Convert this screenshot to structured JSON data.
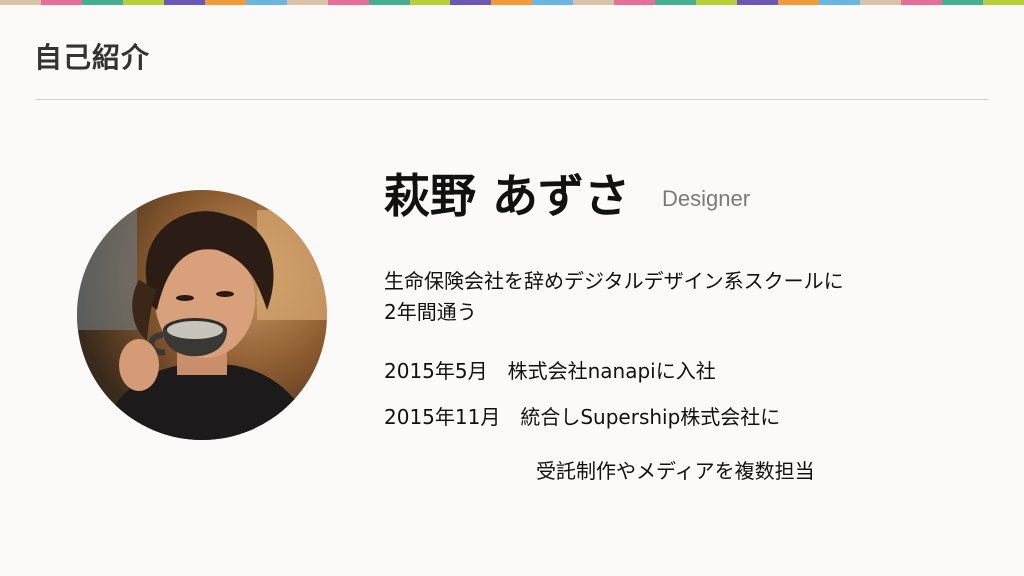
{
  "header": {
    "title": "自己紹介"
  },
  "stripe_colors": [
    "#d8c2a8",
    "#e86e9a",
    "#44b090",
    "#b7cf3a",
    "#6b58b6",
    "#f09a3a",
    "#6bb6e0",
    "#d8c2a8",
    "#e86e9a",
    "#44b090",
    "#b7cf3a",
    "#6b58b6",
    "#f09a3a",
    "#6bb6e0",
    "#d8c2a8",
    "#e86e9a",
    "#44b090",
    "#b7cf3a",
    "#6b58b6",
    "#f09a3a",
    "#6bb6e0",
    "#d8c2a8",
    "#e86e9a",
    "#44b090",
    "#b7cf3a"
  ],
  "profile": {
    "name": "萩野 あずさ",
    "role": "Designer",
    "bio_lines": [
      "生命保険会社を辞めデジタルデザイン系スクールに",
      "2年間通う",
      "2015年5月　株式会社nanapiに入社",
      "2015年11月　統合しSupership株式会社に",
      "受託制作やメディアを複数担当"
    ]
  }
}
